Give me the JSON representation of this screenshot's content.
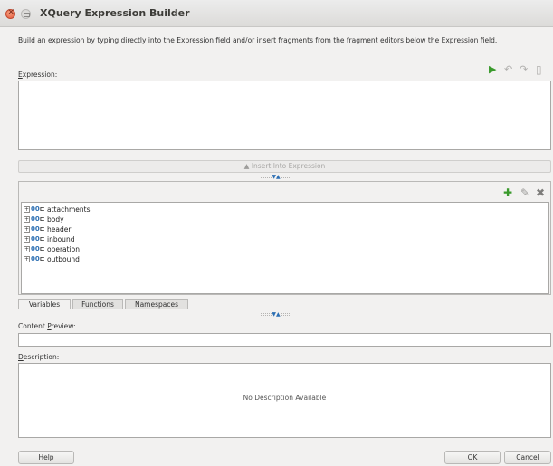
{
  "window": {
    "title": "XQuery Expression Builder"
  },
  "intro_text": "Build an expression by typing directly into the Expression field and/or insert fragments from the fragment editors below the Expression field.",
  "expression": {
    "label_mnemonic": "E",
    "label_rest": "xpression:",
    "value": "",
    "icons": [
      "run-icon",
      "undo-icon",
      "redo-icon",
      "new-icon"
    ]
  },
  "insert_button": {
    "label": "Insert Into Expression"
  },
  "variables_panel": {
    "icons": [
      "add-icon",
      "edit-icon",
      "delete-icon"
    ],
    "tree_items": [
      {
        "name": "attachments"
      },
      {
        "name": "body"
      },
      {
        "name": "header"
      },
      {
        "name": "inbound"
      },
      {
        "name": "operation"
      },
      {
        "name": "outbound"
      }
    ],
    "tree_expand_glyph": "+",
    "tree_type_glyph": "00"
  },
  "tabs": [
    {
      "label": "Variables",
      "active": true
    },
    {
      "label": "Functions",
      "active": false
    },
    {
      "label": "Namespaces",
      "active": false
    }
  ],
  "content_preview": {
    "label_before": "Content ",
    "label_mnemonic": "P",
    "label_rest": "review:",
    "value": ""
  },
  "description": {
    "label_mnemonic": "D",
    "label_rest": "escription:",
    "value": "No Description Available"
  },
  "buttons": {
    "help_mnemonic": "H",
    "help_rest": "elp",
    "ok": "OK",
    "cancel": "Cancel"
  },
  "colors": {
    "accent_green": "#3a9a2c",
    "icon_disabled": "#b0afad",
    "splitter_arrow": "#2c6fb3"
  }
}
